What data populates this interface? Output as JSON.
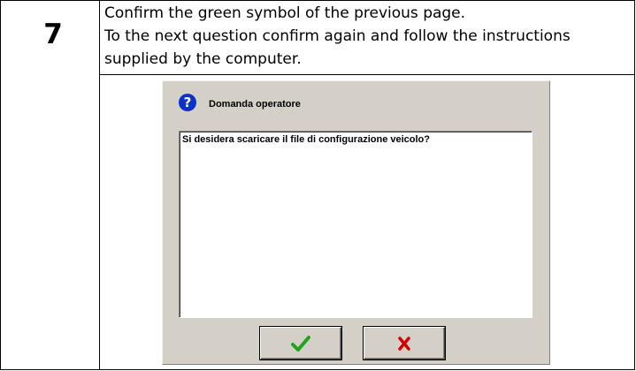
{
  "step": {
    "number": "7",
    "instructions": [
      "Confirm the green symbol of the previous page.",
      "To the next question confirm again and follow the instructions",
      "supplied by the computer."
    ]
  },
  "dialog": {
    "icon": "question-icon",
    "icon_glyph": "?",
    "title": "Domanda operatore",
    "message": "Si desidera scaricare il file di configurazione veicolo?",
    "buttons": {
      "confirm_icon": "green-checkmark-icon",
      "cancel_icon": "red-x-icon"
    }
  },
  "colors": {
    "confirm": "#1fa31f",
    "cancel": "#d40000",
    "icon_blue": "#0b33c9",
    "dialog_bg": "#d4d0c8"
  }
}
